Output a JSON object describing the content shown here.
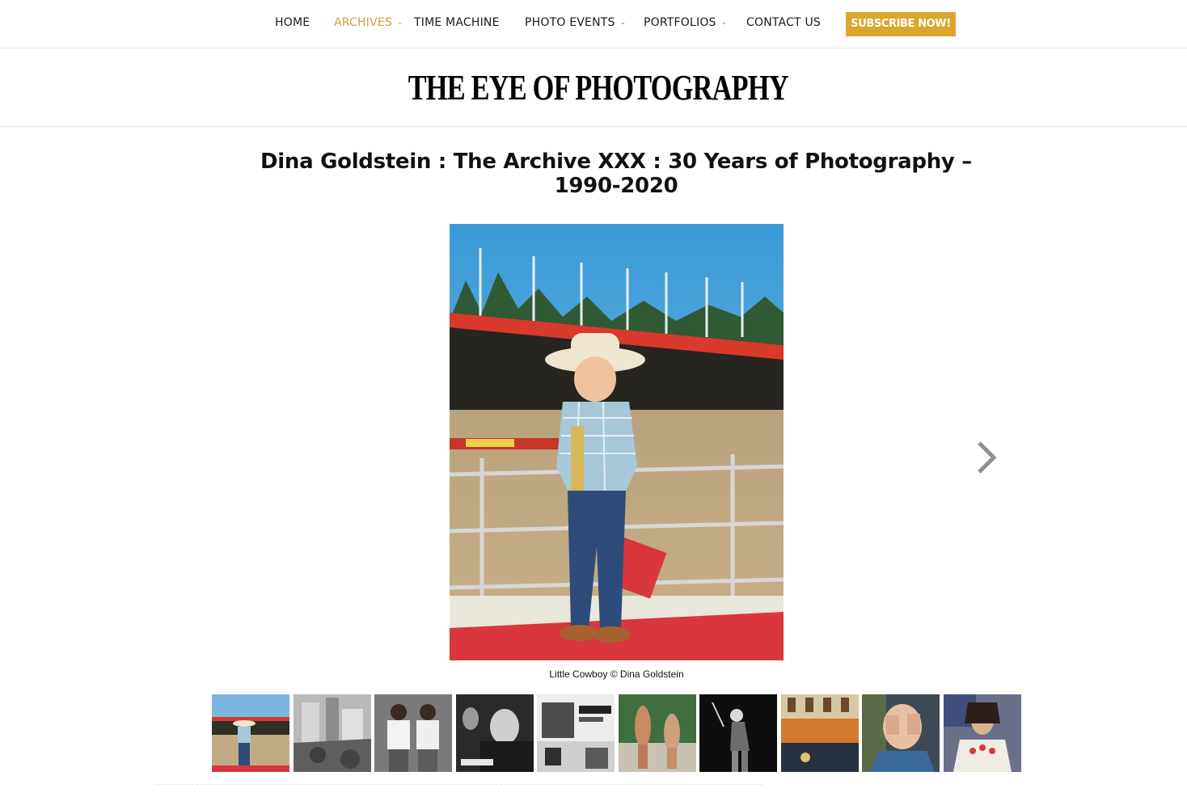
{
  "nav": {
    "items": [
      {
        "label": "HOME",
        "has_submenu": false,
        "active": false
      },
      {
        "label": "ARCHIVES",
        "has_submenu": true,
        "active": true
      },
      {
        "label": "TIME MACHINE",
        "has_submenu": false,
        "active": false
      },
      {
        "label": "PHOTO EVENTS",
        "has_submenu": true,
        "active": false
      },
      {
        "label": "PORTFOLIOS",
        "has_submenu": true,
        "active": false
      },
      {
        "label": "CONTACT US",
        "has_submenu": false,
        "active": false
      }
    ],
    "subscribe_label": "SUBSCRIBE NOW!"
  },
  "site": {
    "logo_text": "THE EYE OF PHOTOGRAPHY"
  },
  "article": {
    "title": "Dina Goldstein : The Archive XXX : 30 Years of Photography – 1990-2020"
  },
  "gallery": {
    "caption": "Little Cowboy © Dina Goldstein",
    "next_icon": "chevron-right-icon",
    "thumbnail_count": 10
  },
  "colors": {
    "accent": "#c9a13b",
    "subscribe_bg": "#d9a72e",
    "text": "#111111"
  }
}
